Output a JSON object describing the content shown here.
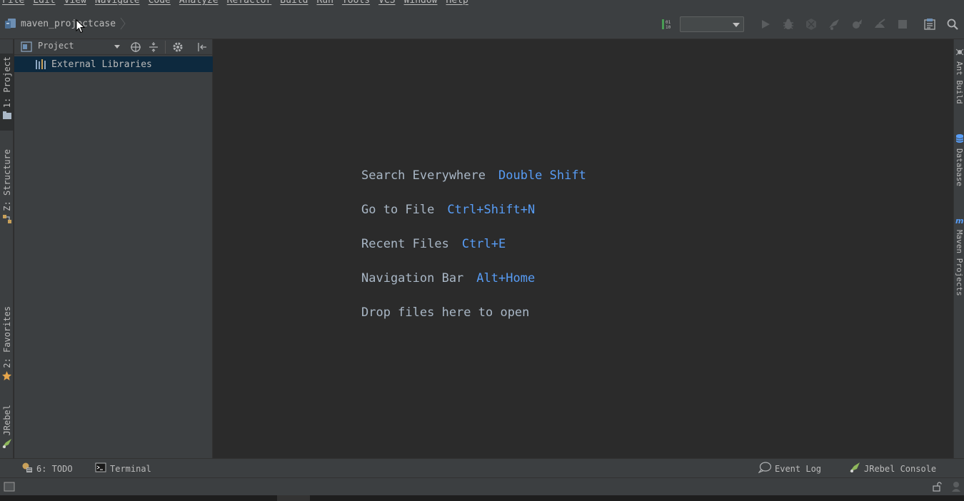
{
  "menu": {
    "items": [
      "File",
      "Edit",
      "View",
      "Navigate",
      "Code",
      "Analyze",
      "Refactor",
      "Build",
      "Run",
      "Tools",
      "VCS",
      "Window",
      "Help"
    ]
  },
  "navbar": {
    "project_name": "maven_projectcase",
    "run_config_value": ""
  },
  "left_tabs": [
    {
      "label": "1: Project"
    },
    {
      "label": "Z: Structure"
    },
    {
      "label": "2: Favorites"
    },
    {
      "label": "JRebel"
    }
  ],
  "right_tabs": [
    {
      "label": "Ant Build"
    },
    {
      "label": "Database"
    },
    {
      "label": "Maven Projects"
    }
  ],
  "project_panel": {
    "title": "Project",
    "tree": [
      {
        "label": "External Libraries"
      }
    ]
  },
  "editor": {
    "hints": [
      {
        "label": "Search Everywhere",
        "key": "Double Shift"
      },
      {
        "label": "Go to File",
        "key": "Ctrl+Shift+N"
      },
      {
        "label": "Recent Files",
        "key": "Ctrl+E"
      },
      {
        "label": "Navigation Bar",
        "key": "Alt+Home"
      },
      {
        "label": "Drop files here to open",
        "key": ""
      }
    ]
  },
  "bottom_tabs": {
    "todo": "6: TODO",
    "terminal": "Terminal",
    "event_log": "Event Log",
    "jrebel_console": "JRebel Console"
  },
  "colors": {
    "background": "#2b2b2b",
    "panel": "#3c3f41",
    "selection": "#0d293e",
    "shortcut": "#589df6",
    "text": "#bbbbbb"
  }
}
